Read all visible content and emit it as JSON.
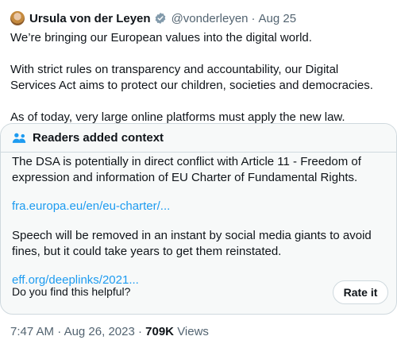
{
  "author": {
    "name": "Ursula von der Leyen",
    "handle": "@vonderleyen",
    "separator": "·",
    "date": "Aug 25"
  },
  "tweet": {
    "paragraphs": [
      "We’re bringing our European values into the digital world.",
      "With strict rules on transparency and accountability, our Digital Services Act aims to protect our children, societies and democracies.",
      "As of today, very large online platforms must apply the new law."
    ]
  },
  "context_note": {
    "title": "Readers added context",
    "paragraph1": "The DSA is potentially in direct conflict with  Article 11 - Freedom of expression and information of EU Charter of Fundamental Rights.",
    "link1": "fra.europa.eu/en/eu-charter/...",
    "paragraph2": "Speech will be removed in an instant by social media giants to avoid fines, but it could take years to get them reinstated.",
    "link2": "eff.org/deeplinks/2021...",
    "helpful_question": "Do you find this helpful?",
    "rate_label": "Rate it"
  },
  "meta": {
    "time": "7:47 AM",
    "separator": "·",
    "date": "Aug 26, 2023",
    "views_count": "709K",
    "views_label": "Views"
  },
  "colors": {
    "verified_badge": "#829aab",
    "link": "#1d9bf0",
    "muted_text": "#536471",
    "border": "#cfd9de",
    "note_background": "#f7f9f9"
  },
  "icons": {
    "verified": "verified-badge-icon",
    "people": "people-icon"
  }
}
